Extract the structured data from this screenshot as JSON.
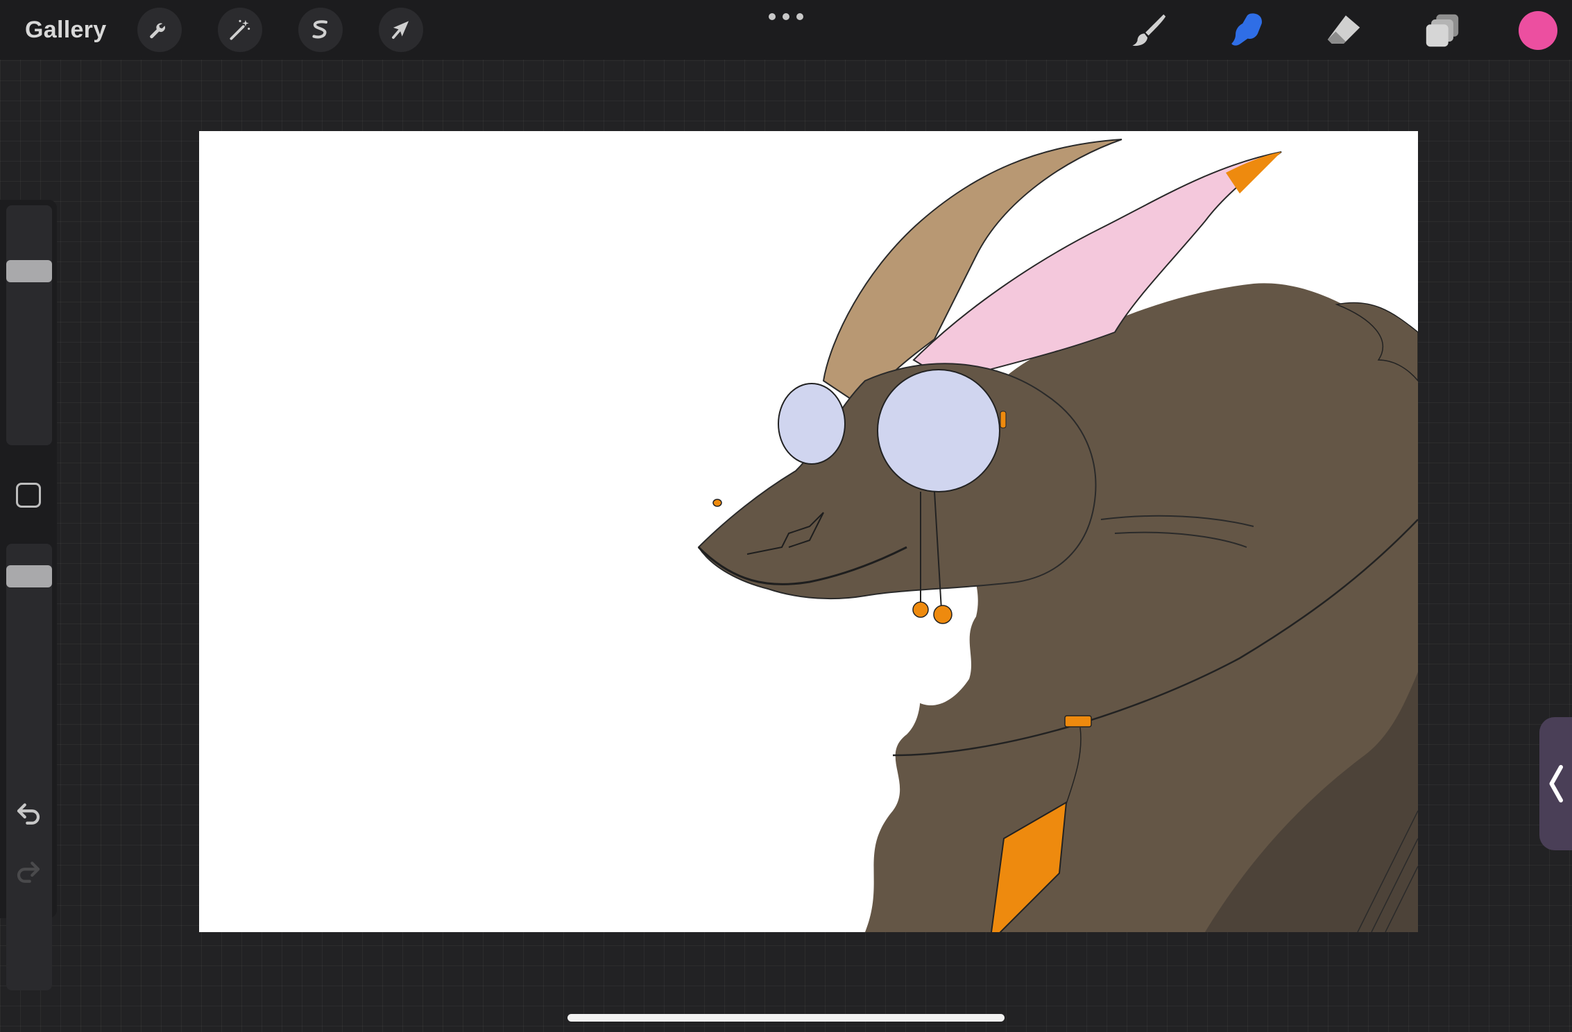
{
  "app": {
    "gallery_label": "Gallery"
  },
  "toolbar_left": [
    {
      "name": "actions-button",
      "icon": "wrench-icon"
    },
    {
      "name": "adjustments-button",
      "icon": "magic-wand-icon"
    },
    {
      "name": "selection-button",
      "icon": "selection-s-icon"
    },
    {
      "name": "transform-button",
      "icon": "arrow-cursor-icon"
    }
  ],
  "toolbar_right": [
    {
      "name": "brush-tool",
      "icon": "brush-icon",
      "active": false
    },
    {
      "name": "smudge-tool",
      "icon": "smudge-finger-icon",
      "active": true
    },
    {
      "name": "eraser-tool",
      "icon": "eraser-icon",
      "active": false
    },
    {
      "name": "layers-button",
      "icon": "layers-icon",
      "active": false
    }
  ],
  "colors": {
    "current_color": "#ec4fa0",
    "active_tool": "#2f6ee6",
    "tool_icon": "#d0d0d0",
    "canvas_bg": "#ffffff",
    "fur_main": "#645646",
    "fur_shadow": "#4d4339",
    "lens": "#d0d5ef",
    "accent_orange": "#ee8a0e",
    "ear_pink": "#f4c8dc",
    "horn_tan": "#b89873"
  },
  "sidebar": {
    "brush_size_level": 0.25,
    "opacity_level": 0.05
  }
}
